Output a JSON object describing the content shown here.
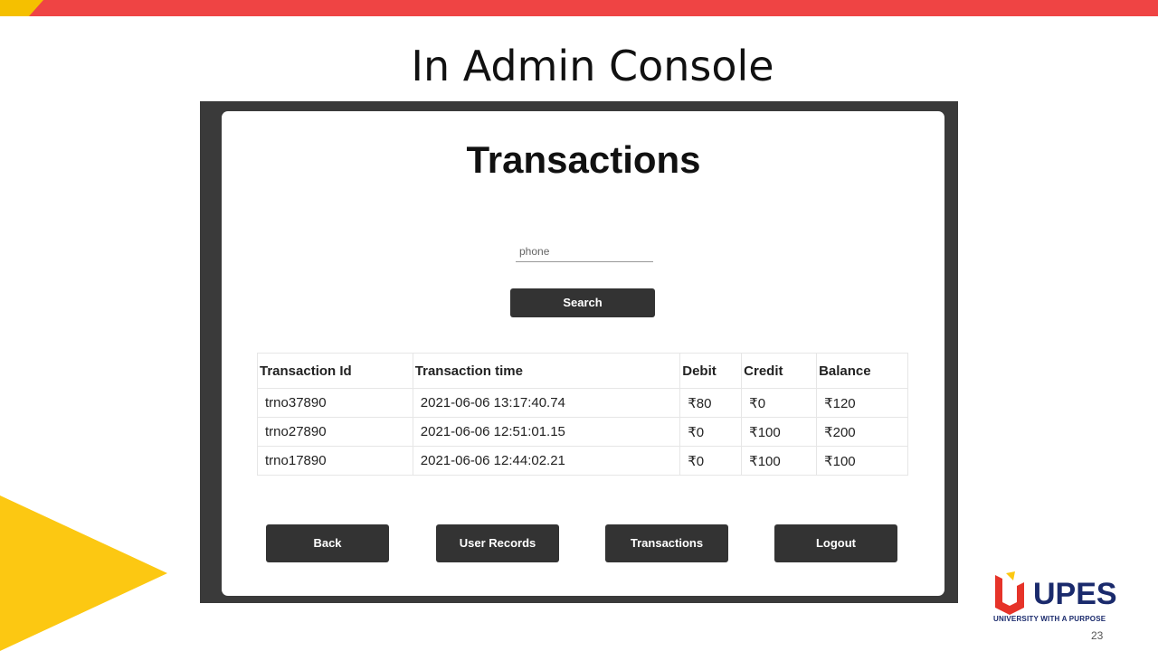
{
  "slide": {
    "title": "In Admin Console",
    "page_number": "23"
  },
  "app": {
    "heading": "Transactions",
    "search": {
      "placeholder": "phone",
      "button_label": "Search"
    },
    "table": {
      "headers": [
        "Transaction Id",
        "Transaction time",
        "Debit",
        "Credit",
        "Balance"
      ],
      "rows": [
        [
          "trno37890",
          "2021-06-06 13:17:40.74",
          "₹80",
          "₹0",
          "₹120"
        ],
        [
          "trno27890",
          "2021-06-06 12:51:01.15",
          "₹0",
          "₹100",
          "₹200"
        ],
        [
          "trno17890",
          "2021-06-06 12:44:02.21",
          "₹0",
          "₹100",
          "₹100"
        ]
      ]
    },
    "nav": {
      "back": "Back",
      "user_records": "User Records",
      "transactions": "Transactions",
      "logout": "Logout"
    }
  },
  "branding": {
    "name": "UPES",
    "tagline": "UNIVERSITY WITH A PURPOSE"
  },
  "colors": {
    "top_bar": "#ef4444",
    "accent_yellow": "#fcc812",
    "frame": "#3a3a3a",
    "button": "#333333",
    "brand_blue": "#1a2a6c",
    "brand_red": "#e63329"
  }
}
